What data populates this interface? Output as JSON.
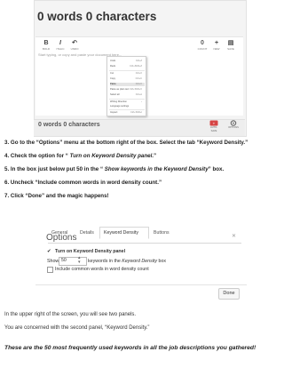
{
  "counter_panel": {
    "headline": "0 words 0 characters",
    "toolbar": {
      "left": [
        {
          "glyph": "B",
          "label": "BOLD"
        },
        {
          "glyph": "I",
          "label": "ITALIC"
        },
        {
          "glyph": "↶",
          "label": "UNDO"
        }
      ],
      "right": [
        {
          "glyph": "0",
          "label": "COUNT"
        },
        {
          "glyph": "+",
          "label": "NEW"
        },
        {
          "glyph": "▤",
          "label": "SAVE"
        }
      ]
    },
    "editor_placeholder": "Start typing, or copy and paste your document here...",
    "context_menu": {
      "items": [
        {
          "label": "Undo",
          "shortcut": "Ctrl+Z"
        },
        {
          "label": "Redo",
          "shortcut": "Ctrl+Shift+Z"
        },
        {
          "label": "Cut",
          "shortcut": "Ctrl+X"
        },
        {
          "label": "Copy",
          "shortcut": "Ctrl+C"
        },
        {
          "label": "Paste",
          "shortcut": "Ctrl+V"
        },
        {
          "label": "Paste as plain text",
          "shortcut": "Ctrl+Shift+V"
        },
        {
          "label": "Select all",
          "shortcut": "Ctrl+A"
        },
        {
          "label": "Writing Direction",
          "shortcut": "›"
        },
        {
          "label": "Language settings",
          "shortcut": ""
        },
        {
          "label": "Inspect",
          "shortcut": "Ctrl+Shift+I"
        }
      ]
    },
    "footer_count": "0 words 0 characters",
    "footer_buttons": [
      {
        "label": "AUTO-SAVE",
        "color": "#d64545"
      },
      {
        "label": "OPTIONS",
        "color": "#666666"
      }
    ]
  },
  "steps": [
    "3. Go to the “Options” menu at the bottom right of the box. Select the tab “Keyword Density.”",
    "4. Check the option for “ Turn on Keyword Density panel.”",
    "5. In the box just below put 50 in the “ Show keywords in the Keyword Density” box.",
    "6. Uncheck “Include common words in word density count.”",
    "7. Click “Done” and the magic happens!"
  ],
  "options_dialog": {
    "title": "Options",
    "tabs": [
      "General",
      "Details",
      "Keyword Density",
      "Buttons"
    ],
    "active_tab": "Keyword Density",
    "turn_on_label": "Turn on Keyword Density panel",
    "turn_on_checked": true,
    "show_label": "Show",
    "show_value": "50",
    "show_after_plain": "keywords in the ",
    "show_after_italic": "Keyword Density",
    "show_after_tail": " box",
    "include_common_label": "Include common words in word density count",
    "include_common_checked": false,
    "done_label": "Done"
  },
  "paragraphs": [
    "In the upper right of the screen, you will see two panels.",
    "You are concerned with the second panel, “Keyword Density.”"
  ],
  "final_line": "These are the 50 most frequently used keywords in all the job descriptions you gathered!"
}
